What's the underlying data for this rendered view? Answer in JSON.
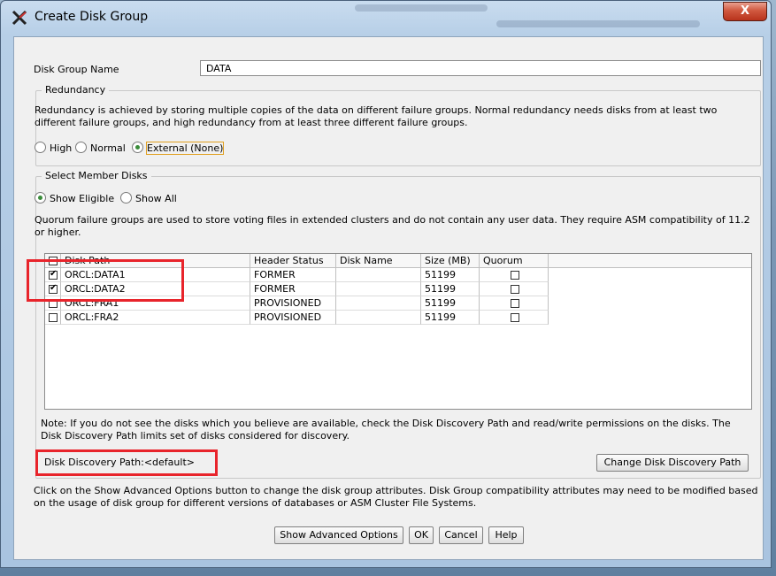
{
  "window": {
    "title": "Create Disk Group",
    "close_label": "X"
  },
  "form": {
    "name_label": "Disk Group Name",
    "name_value": "DATA"
  },
  "redundancy": {
    "legend": "Redundancy",
    "description": "Redundancy is achieved by storing multiple copies of the data on different failure groups. Normal redundancy needs disks from at least two different failure groups, and high redundancy from at least three different failure groups.",
    "options": [
      {
        "label": "High",
        "selected": false
      },
      {
        "label": "Normal",
        "selected": false
      },
      {
        "label": "External (None)",
        "selected": true
      }
    ]
  },
  "member_disks": {
    "legend": "Select Member Disks",
    "filter_options": [
      {
        "label": "Show Eligible",
        "selected": true
      },
      {
        "label": "Show All",
        "selected": false
      }
    ],
    "quorum_note": "Quorum failure groups are used to store voting files in extended clusters and do not contain any user data. They require ASM compatibility of 11.2 or higher.",
    "columns": [
      "Disk Path",
      "Header Status",
      "Disk Name",
      "Size (MB)",
      "Quorum"
    ],
    "rows": [
      {
        "selected": true,
        "path": "ORCL:DATA1",
        "status": "FORMER",
        "name": "",
        "size": "51199",
        "quorum": false
      },
      {
        "selected": true,
        "path": "ORCL:DATA2",
        "status": "FORMER",
        "name": "",
        "size": "51199",
        "quorum": false
      },
      {
        "selected": false,
        "path": "ORCL:FRA1",
        "status": "PROVISIONED",
        "name": "",
        "size": "51199",
        "quorum": false
      },
      {
        "selected": false,
        "path": "ORCL:FRA2",
        "status": "PROVISIONED",
        "name": "",
        "size": "51199",
        "quorum": false
      }
    ],
    "discovery_note": "Note: If you do not see the disks which you believe are available, check the Disk Discovery Path and read/write permissions on the disks. The Disk Discovery Path limits set of disks considered for discovery.",
    "discovery_path_label": "Disk Discovery Path:<default>",
    "change_path_button": "Change Disk Discovery Path"
  },
  "advanced_note": "Click on the Show Advanced Options button to change the disk group attributes. Disk Group compatibility attributes may need to be modified based on the usage of disk group for different versions of databases or ASM Cluster File Systems.",
  "buttons": {
    "advanced": "Show Advanced Options",
    "ok": "OK",
    "cancel": "Cancel",
    "help": "Help"
  },
  "colors": {
    "highlight": "#e8242b",
    "selected_radio": "#3a8c3a"
  }
}
